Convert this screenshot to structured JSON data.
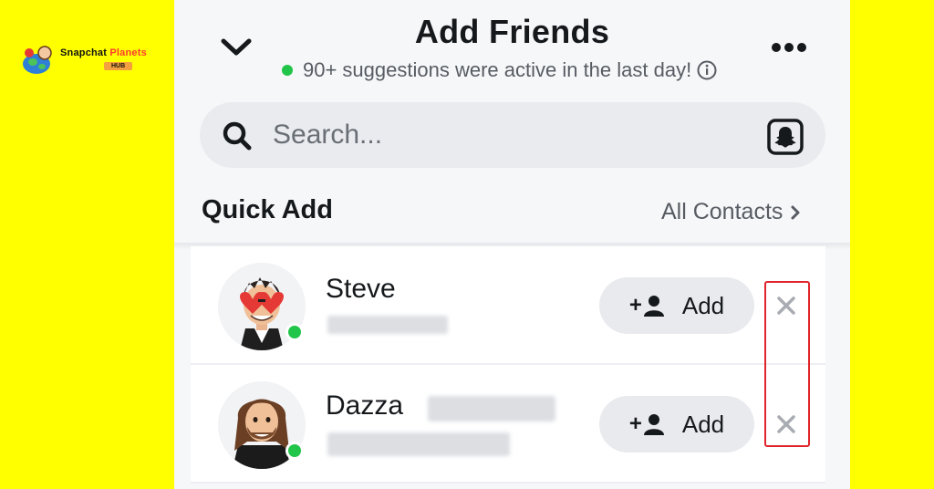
{
  "watermark": {
    "title_part1": "Snapchat",
    "title_part2": "Planets",
    "badge": "HUB"
  },
  "header": {
    "title": "Add Friends",
    "subtitle": "90+ suggestions were active in the last day!",
    "back_icon": "chevron-down-icon",
    "more_icon": "more-dots-icon"
  },
  "search": {
    "placeholder": "Search...",
    "icon": "search-icon",
    "scan_icon": "snapcode-icon"
  },
  "quick_add": {
    "title": "Quick Add",
    "all_contacts_label": "All Contacts"
  },
  "suggestions": [
    {
      "name": "Steve",
      "add_label": "Add",
      "online": true
    },
    {
      "name": "Dazza",
      "add_label": "Add",
      "online": true
    }
  ],
  "colors": {
    "background": "#FFFF00",
    "online": "#21C549",
    "highlight_box": "#E0242B"
  }
}
